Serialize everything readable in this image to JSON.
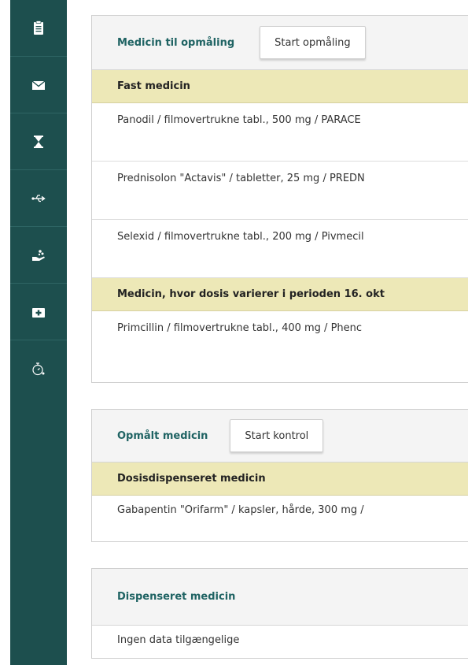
{
  "sidebar": {
    "items": [
      {
        "icon": "clipboard-icon"
      },
      {
        "icon": "envelope-icon"
      },
      {
        "icon": "hourglass-icon"
      },
      {
        "icon": "usb-icon"
      },
      {
        "icon": "hand-pill-icon"
      },
      {
        "icon": "medical-kit-icon"
      },
      {
        "icon": "timer-icon"
      }
    ],
    "colors": {
      "background": "#1d4f4e",
      "icon": "#ffffff"
    }
  },
  "panels": {
    "to_measure": {
      "title": "Medicin til opmåling",
      "button": "Start opmåling",
      "groups": {
        "fixed": {
          "label": "Fast medicin",
          "rows": [
            "Panodil / filmovertrukne tabl., 500 mg / PARACE",
            "Prednisolon \"Actavis\" / tabletter, 25 mg / PREDN",
            "Selexid / filmovertrukne tabl., 200 mg / Pivmecil"
          ]
        },
        "varying": {
          "label": "Medicin, hvor dosis varierer i perioden 16. okt",
          "rows": [
            "Primcillin / filmovertrukne tabl., 400 mg / Phenc"
          ]
        }
      }
    },
    "measured": {
      "title": "Opmålt medicin",
      "button": "Start kontrol",
      "groups": {
        "dose_dispensed": {
          "label": "Dosisdispenseret medicin",
          "rows": [
            "Gabapentin \"Orifarm\" / kapsler, hårde, 300 mg /"
          ]
        }
      }
    },
    "dispensed": {
      "title": "Dispenseret medicin",
      "rows": [
        "Ingen data tilgængelige"
      ]
    }
  },
  "colors": {
    "title_teal": "#1f6363",
    "group_yellow": "#ede8b7",
    "header_grey": "#f4f4f4"
  }
}
